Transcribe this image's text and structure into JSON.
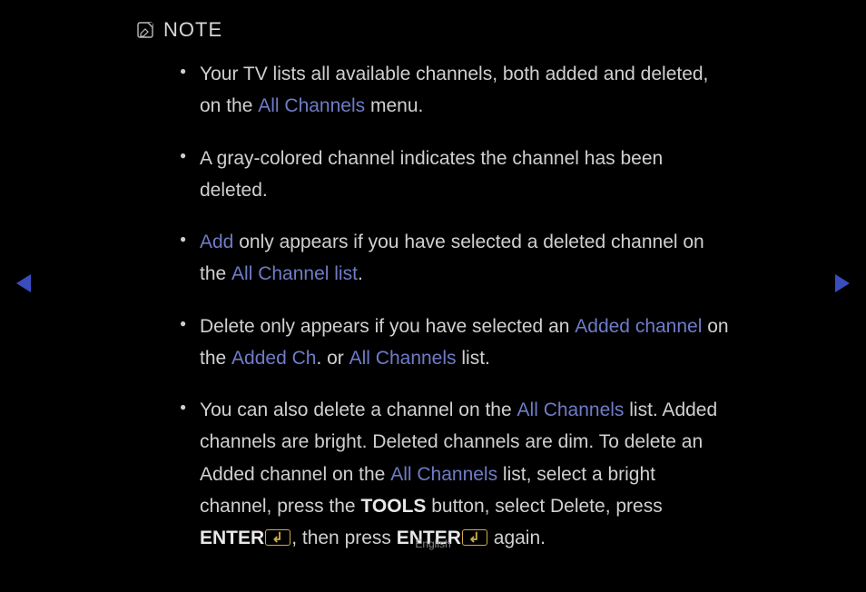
{
  "note": {
    "label": "NOTE"
  },
  "bullets": {
    "b1": {
      "t1": "Your TV lists all available channels, both added and deleted, on the ",
      "hl1": "All Channels",
      "t2": " menu."
    },
    "b2": {
      "t1": "A gray-colored channel indicates the channel has been deleted."
    },
    "b3": {
      "hl1": "Add",
      "t1": " only appears if you have selected a deleted channel on the ",
      "hl2": "All Channel list",
      "t2": "."
    },
    "b4": {
      "t1": "Delete only appears if you have selected an ",
      "hl1": "Added channel",
      "t2": " on the ",
      "hl2": "Added Ch",
      "t3": ". or ",
      "hl3": "All Channels",
      "t4": " list."
    },
    "b5": {
      "t1": "You can also delete a channel on the ",
      "hl1": "All Channels",
      "t2": " list. Added channels are bright. Deleted channels are dim. To delete an Added channel on the ",
      "hl2": "All Channels",
      "t3": " list, select a bright channel, press the ",
      "bold1": "TOOLS",
      "t4": " button, select Delete, press ",
      "bold2": "ENTER",
      "t5": ", then press ",
      "bold3": "ENTER",
      "t6": " again."
    }
  },
  "footer": {
    "language": "English"
  }
}
